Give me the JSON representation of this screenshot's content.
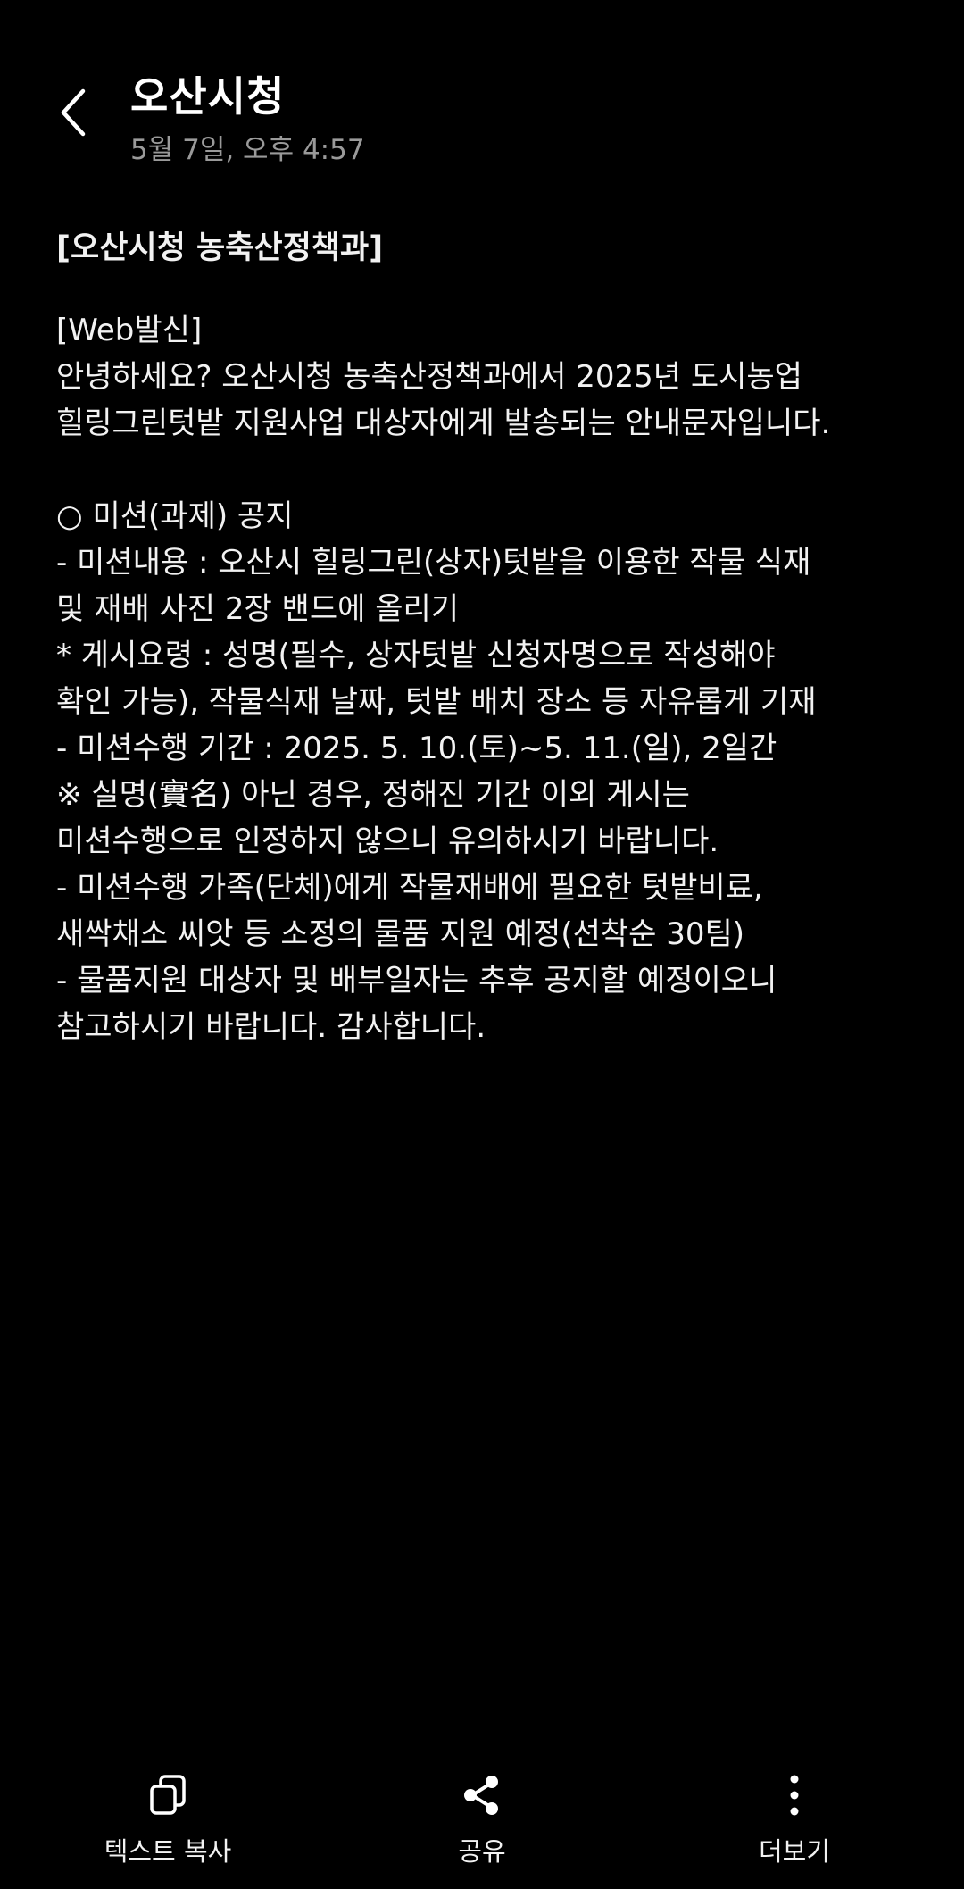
{
  "header": {
    "title": "오산시청",
    "timestamp": "5월 7일, 오후 4:57"
  },
  "message": {
    "heading": "[오산시청 농축산정책과]",
    "lines": [
      "[Web발신]",
      "안녕하세요? 오산시청 농축산정책과에서 2025년 도시농업",
      "힐링그린텃밭 지원사업 대상자에게 발송되는 안내문자입니다.",
      "",
      "○ 미션(과제) 공지",
      "  - 미션내용 : 오산시 힐링그린(상자)텃밭을 이용한 작물 식재",
      "및 재배 사진 2장 밴드에 올리기",
      "   * 게시요령 : 성명(필수, 상자텃밭 신청자명으로 작성해야",
      "확인 가능), 작물식재 날짜, 텃밭 배치 장소 등 자유롭게 기재",
      "  - 미션수행 기간 : 2025. 5. 10.(토)~5. 11.(일), 2일간",
      "  ※ 실명(實名) 아닌 경우, 정해진 기간 이외 게시는",
      "미션수행으로 인정하지 않으니 유의하시기 바랍니다.",
      "  - 미션수행 가족(단체)에게 작물재배에 필요한 텃밭비료,",
      "새싹채소 씨앗 등 소정의 물품 지원 예정(선착순 30팀)",
      "  - 물품지원 대상자 및 배부일자는 추후 공지할 예정이오니",
      "참고하시기 바랍니다. 감사합니다."
    ]
  },
  "bottom_bar": {
    "copy_label": "텍스트 복사",
    "share_label": "공유",
    "more_label": "더보기"
  },
  "icons": {
    "back": "chevron-left-icon",
    "copy": "copy-icon",
    "share": "share-icon",
    "more": "more-vertical-icon"
  },
  "colors": {
    "background": "#000000",
    "text": "#f2f2f2",
    "secondary_text": "#9a9a9a"
  }
}
